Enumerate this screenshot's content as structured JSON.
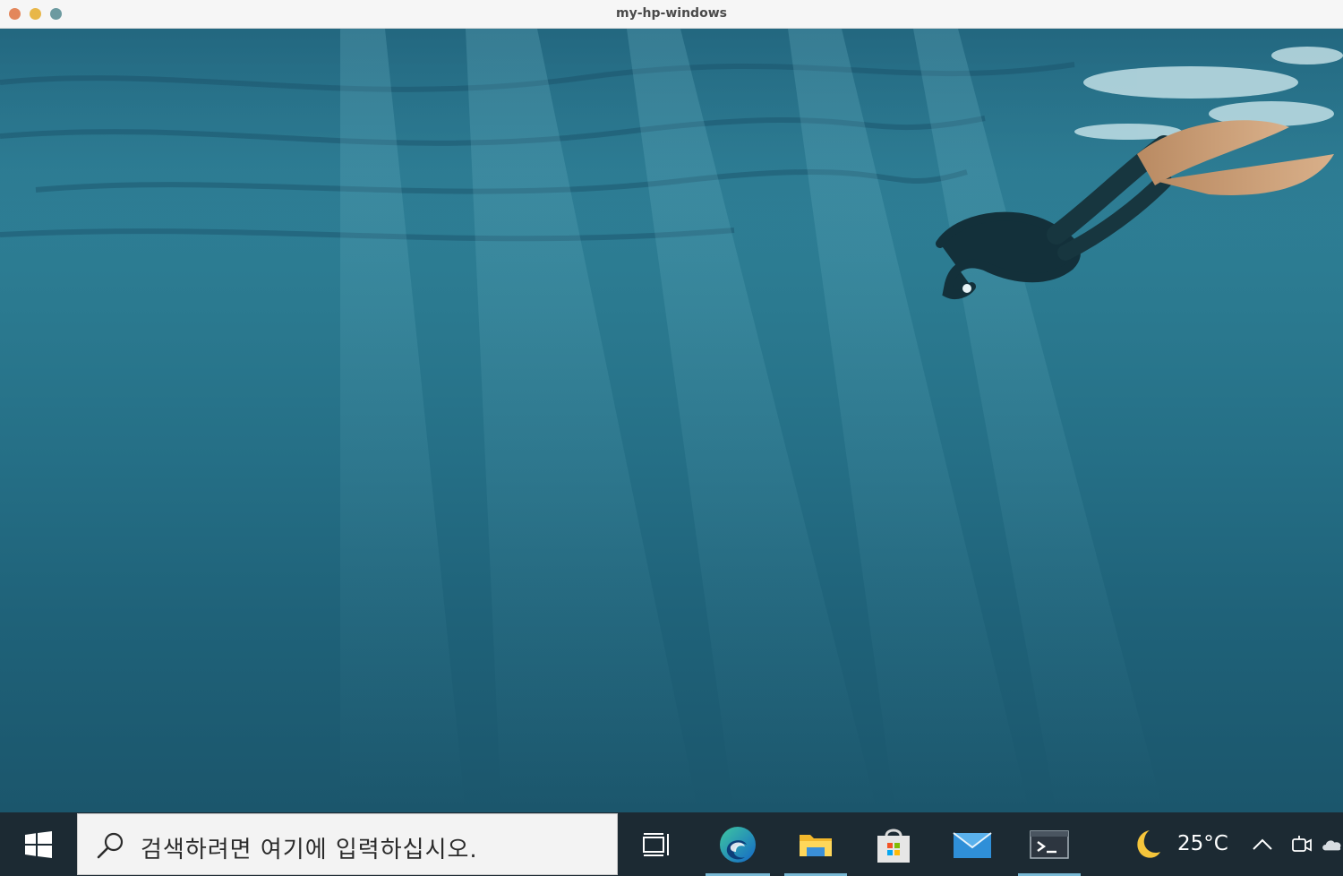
{
  "window": {
    "title": "my-hp-windows"
  },
  "search": {
    "placeholder": "검색하려면 여기에 입력하십시오."
  },
  "taskbar": {
    "apps": [
      {
        "name": "Edge",
        "active": true
      },
      {
        "name": "File Explorer",
        "active": true
      },
      {
        "name": "Microsoft Store",
        "active": false
      },
      {
        "name": "Mail",
        "active": false
      },
      {
        "name": "Terminal",
        "active": true
      }
    ],
    "weather": {
      "icon": "moon-icon",
      "temperature": "25°C"
    }
  },
  "colors": {
    "taskbar": "#1c2a33",
    "water_top": "#2c7a91",
    "water_bottom": "#1b566c",
    "active_indicator": "#78b8d4"
  }
}
